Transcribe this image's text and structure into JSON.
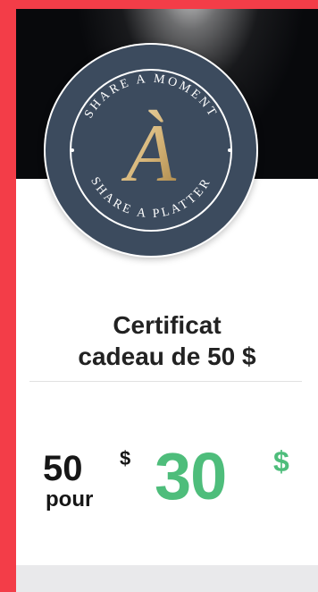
{
  "logo": {
    "top_arc_text": "SHARE A MOMENT",
    "bottom_arc_text": "SHARE A PLATTER",
    "monogram": "À",
    "background_color": "#3c4b5e",
    "accent_color": "#d7b67a"
  },
  "card": {
    "title_line1": "Certificat",
    "title_line2": "cadeau de 50 $"
  },
  "pricing": {
    "original_value": "50",
    "original_currency": "$",
    "for_label": "pour",
    "sale_value": "30",
    "sale_currency": "$"
  },
  "colors": {
    "brand_red": "#f33d48",
    "sale_green": "#4ebd7b",
    "title_text": "#222222"
  }
}
